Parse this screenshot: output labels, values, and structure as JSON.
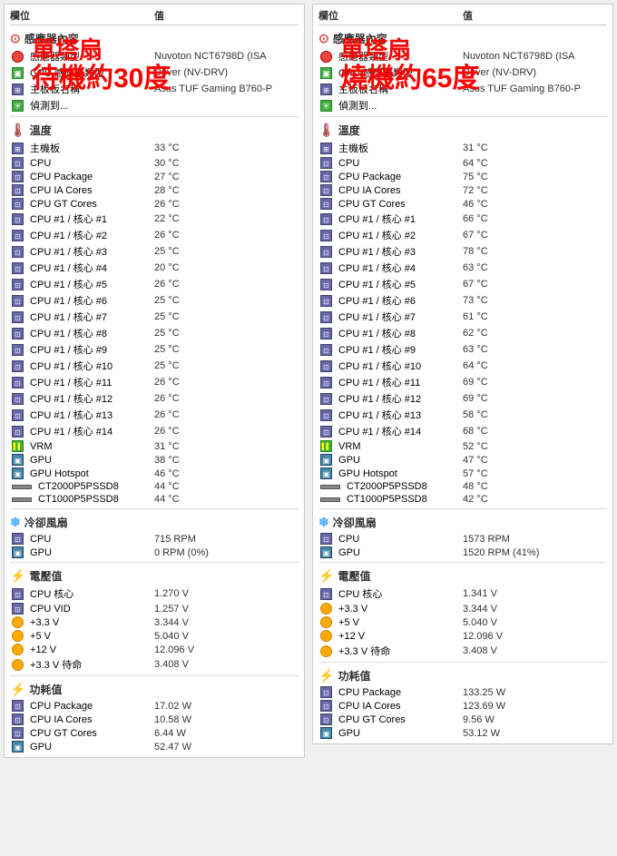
{
  "panels": [
    {
      "id": "left",
      "header": {
        "col1": "欄位",
        "col2": "值"
      },
      "watermark": {
        "line1": "單塔扇",
        "line2": "待機約30度"
      },
      "sensor_section": {
        "title": "感應器內容",
        "rows": [
          {
            "label": "感應器類型",
            "value": "Nuvoton NCT6798D (ISA",
            "icon": "circle-red"
          },
          {
            "label": "GPU 感應器類型",
            "value": "Driver (NV-DRV)",
            "icon": "monitor-green"
          },
          {
            "label": "主板板名稱",
            "value": "Asus TUF Gaming B760-P",
            "icon": "board"
          },
          {
            "label": "偵測到...",
            "value": "",
            "icon": "shield"
          }
        ]
      },
      "temp_section": {
        "title": "溫度",
        "rows": [
          {
            "label": "主機板",
            "value": "33 °C",
            "icon": "board"
          },
          {
            "label": "CPU",
            "value": "30 °C",
            "icon": "cpu"
          },
          {
            "label": "CPU Package",
            "value": "27 °C",
            "icon": "cpu"
          },
          {
            "label": "CPU IA Cores",
            "value": "28 °C",
            "icon": "cpu"
          },
          {
            "label": "CPU GT Cores",
            "value": "26 °C",
            "icon": "cpu"
          },
          {
            "label": "CPU #1 / 核心 #1",
            "value": "22 °C",
            "icon": "cpu"
          },
          {
            "label": "CPU #1 / 核心 #2",
            "value": "26 °C",
            "icon": "cpu"
          },
          {
            "label": "CPU #1 / 核心 #3",
            "value": "25 °C",
            "icon": "cpu"
          },
          {
            "label": "CPU #1 / 核心 #4",
            "value": "20 °C",
            "icon": "cpu"
          },
          {
            "label": "CPU #1 / 核心 #5",
            "value": "26 °C",
            "icon": "cpu"
          },
          {
            "label": "CPU #1 / 核心 #6",
            "value": "25 °C",
            "icon": "cpu"
          },
          {
            "label": "CPU #1 / 核心 #7",
            "value": "25 °C",
            "icon": "cpu"
          },
          {
            "label": "CPU #1 / 核心 #8",
            "value": "25 °C",
            "icon": "cpu"
          },
          {
            "label": "CPU #1 / 核心 #9",
            "value": "25 °C",
            "icon": "cpu"
          },
          {
            "label": "CPU #1 / 核心 #10",
            "value": "25 °C",
            "icon": "cpu"
          },
          {
            "label": "CPU #1 / 核心 #11",
            "value": "26 °C",
            "icon": "cpu"
          },
          {
            "label": "CPU #1 / 核心 #12",
            "value": "26 °C",
            "icon": "cpu"
          },
          {
            "label": "CPU #1 / 核心 #13",
            "value": "26 °C",
            "icon": "cpu"
          },
          {
            "label": "CPU #1 / 核心 #14",
            "value": "26 °C",
            "icon": "cpu"
          },
          {
            "label": "VRM",
            "value": "31 °C",
            "icon": "vrm"
          },
          {
            "label": "GPU",
            "value": "38 °C",
            "icon": "monitor"
          },
          {
            "label": "GPU Hotspot",
            "value": "46 °C",
            "icon": "monitor"
          },
          {
            "label": "CT2000P5PSSD8",
            "value": "44 °C",
            "icon": "ssd"
          },
          {
            "label": "CT1000P5PSSD8",
            "value": "44 °C",
            "icon": "ssd"
          }
        ]
      },
      "fan_section": {
        "title": "冷卻風扇",
        "rows": [
          {
            "label": "CPU",
            "value": "715 RPM",
            "icon": "cpu"
          },
          {
            "label": "GPU",
            "value": "0 RPM  (0%)",
            "icon": "monitor"
          }
        ]
      },
      "volt_section": {
        "title": "電壓值",
        "rows": [
          {
            "label": "CPU 核心",
            "value": "1.270 V",
            "icon": "cpu"
          },
          {
            "label": "CPU VID",
            "value": "1.257 V",
            "icon": "cpu"
          },
          {
            "label": "+3.3 V",
            "value": "3.344 V",
            "icon": "circle-volt"
          },
          {
            "label": "+5 V",
            "value": "5.040 V",
            "icon": "circle-volt"
          },
          {
            "label": "+12 V",
            "value": "12.096 V",
            "icon": "circle-volt"
          },
          {
            "label": "+3.3 V 待命",
            "value": "3.408 V",
            "icon": "circle-volt"
          }
        ]
      },
      "power_section": {
        "title": "功耗值",
        "rows": [
          {
            "label": "CPU Package",
            "value": "17.02 W",
            "icon": "cpu"
          },
          {
            "label": "CPU IA Cores",
            "value": "10.58 W",
            "icon": "cpu"
          },
          {
            "label": "CPU GT Cores",
            "value": "6.44 W",
            "icon": "cpu"
          },
          {
            "label": "GPU",
            "value": "52.47 W",
            "icon": "monitor"
          }
        ]
      }
    },
    {
      "id": "right",
      "header": {
        "col1": "欄位",
        "col2": "值"
      },
      "watermark": {
        "line1": "單塔扇",
        "line2": "燒機約65度"
      },
      "sensor_section": {
        "title": "感應器內容",
        "rows": [
          {
            "label": "感應器類型",
            "value": "Nuvoton NCT6798D (ISA",
            "icon": "circle-red"
          },
          {
            "label": "GPU 感應器類型",
            "value": "Driver (NV-DRV)",
            "icon": "monitor-green"
          },
          {
            "label": "主板板名稱",
            "value": "Asus TUF Gaming B760-P",
            "icon": "board"
          },
          {
            "label": "偵測到...",
            "value": "",
            "icon": "shield"
          }
        ]
      },
      "temp_section": {
        "title": "溫度",
        "rows": [
          {
            "label": "主機板",
            "value": "31 °C",
            "icon": "board"
          },
          {
            "label": "CPU",
            "value": "64 °C",
            "icon": "cpu"
          },
          {
            "label": "CPU Package",
            "value": "75 °C",
            "icon": "cpu"
          },
          {
            "label": "CPU IA Cores",
            "value": "72 °C",
            "icon": "cpu"
          },
          {
            "label": "CPU GT Cores",
            "value": "46 °C",
            "icon": "cpu"
          },
          {
            "label": "CPU #1 / 核心 #1",
            "value": "66 °C",
            "icon": "cpu"
          },
          {
            "label": "CPU #1 / 核心 #2",
            "value": "67 °C",
            "icon": "cpu"
          },
          {
            "label": "CPU #1 / 核心 #3",
            "value": "78 °C",
            "icon": "cpu"
          },
          {
            "label": "CPU #1 / 核心 #4",
            "value": "63 °C",
            "icon": "cpu"
          },
          {
            "label": "CPU #1 / 核心 #5",
            "value": "67 °C",
            "icon": "cpu"
          },
          {
            "label": "CPU #1 / 核心 #6",
            "value": "73 °C",
            "icon": "cpu"
          },
          {
            "label": "CPU #1 / 核心 #7",
            "value": "61 °C",
            "icon": "cpu"
          },
          {
            "label": "CPU #1 / 核心 #8",
            "value": "62 °C",
            "icon": "cpu"
          },
          {
            "label": "CPU #1 / 核心 #9",
            "value": "63 °C",
            "icon": "cpu"
          },
          {
            "label": "CPU #1 / 核心 #10",
            "value": "64 °C",
            "icon": "cpu"
          },
          {
            "label": "CPU #1 / 核心 #11",
            "value": "69 °C",
            "icon": "cpu"
          },
          {
            "label": "CPU #1 / 核心 #12",
            "value": "69 °C",
            "icon": "cpu"
          },
          {
            "label": "CPU #1 / 核心 #13",
            "value": "58 °C",
            "icon": "cpu"
          },
          {
            "label": "CPU #1 / 核心 #14",
            "value": "68 °C",
            "icon": "cpu"
          },
          {
            "label": "VRM",
            "value": "52 °C",
            "icon": "vrm"
          },
          {
            "label": "GPU",
            "value": "47 °C",
            "icon": "monitor"
          },
          {
            "label": "GPU Hotspot",
            "value": "57 °C",
            "icon": "monitor"
          },
          {
            "label": "CT2000P5PSSD8",
            "value": "48 °C",
            "icon": "ssd"
          },
          {
            "label": "CT1000P5PSSD8",
            "value": "42 °C",
            "icon": "ssd"
          }
        ]
      },
      "fan_section": {
        "title": "冷卻風扇",
        "rows": [
          {
            "label": "CPU",
            "value": "1573 RPM",
            "icon": "cpu"
          },
          {
            "label": "GPU",
            "value": "1520 RPM  (41%)",
            "icon": "monitor"
          }
        ]
      },
      "volt_section": {
        "title": "電壓值",
        "rows": [
          {
            "label": "CPU 核心",
            "value": "1.341 V",
            "icon": "cpu"
          },
          {
            "label": "+3.3 V",
            "value": "3.344 V",
            "icon": "circle-volt"
          },
          {
            "label": "+5 V",
            "value": "5.040 V",
            "icon": "circle-volt"
          },
          {
            "label": "+12 V",
            "value": "12.096 V",
            "icon": "circle-volt"
          },
          {
            "label": "+3.3 V 待命",
            "value": "3.408 V",
            "icon": "circle-volt"
          }
        ]
      },
      "power_section": {
        "title": "功耗值",
        "rows": [
          {
            "label": "CPU Package",
            "value": "133.25 W",
            "icon": "cpu"
          },
          {
            "label": "CPU IA Cores",
            "value": "123.69 W",
            "icon": "cpu"
          },
          {
            "label": "CPU GT Cores",
            "value": "9.56 W",
            "icon": "cpu"
          },
          {
            "label": "GPU",
            "value": "53.12 W",
            "icon": "monitor"
          }
        ]
      }
    }
  ]
}
